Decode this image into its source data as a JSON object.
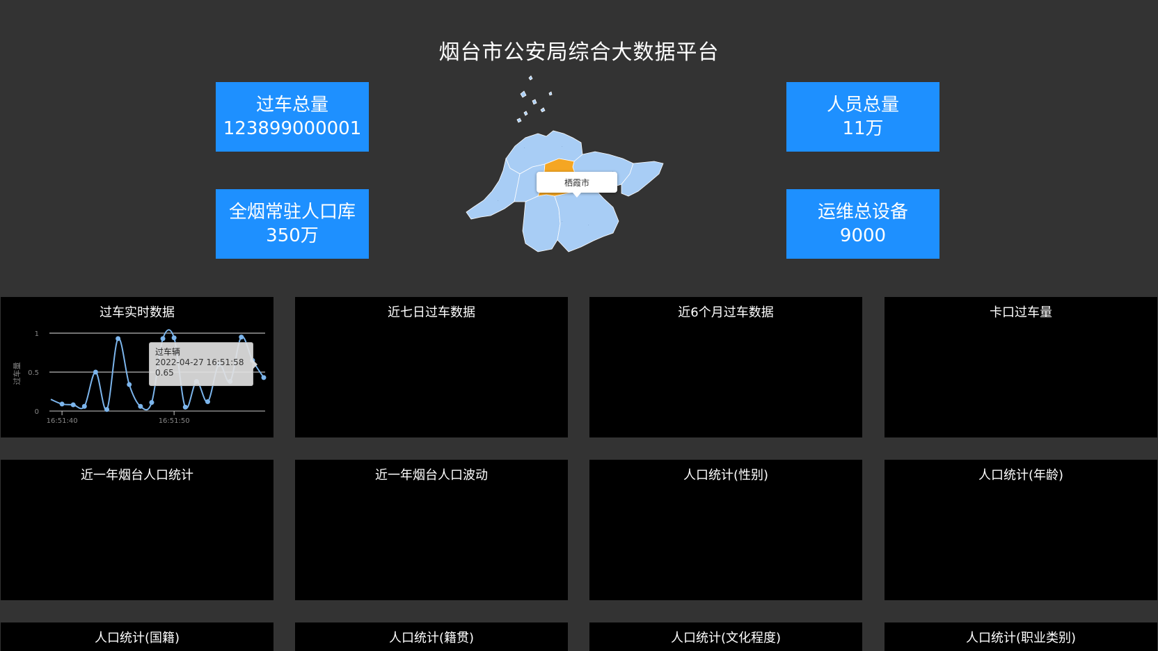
{
  "page": {
    "title": "烟台市公安局综合大数据平台"
  },
  "stats": [
    {
      "label": "过车总量",
      "value": "123899000001"
    },
    {
      "label": "全烟常驻人口库",
      "value": "350万"
    },
    {
      "label": "人员总量",
      "value": "11万"
    },
    {
      "label": "运维总设备",
      "value": "9000"
    }
  ],
  "map": {
    "highlight_label": "栖霞市",
    "highlight_color": "#f5a623",
    "region_color": "#a8cdf5"
  },
  "panels": {
    "row1": [
      "过车实时数据",
      "近七日过车数据",
      "近6个月过车数据",
      "卡口过车量"
    ],
    "row2": [
      "近一年烟台人口统计",
      "近一年烟台人口波动",
      "人口统计(性别)",
      "人口统计(年龄)"
    ],
    "row3": [
      "人口统计(国籍)",
      "人口统计(籍贯)",
      "人口统计(文化程度)",
      "人口统计(职业类别)"
    ]
  },
  "chart_data": {
    "type": "line",
    "title": "过车实时数据",
    "ylabel": "过车量",
    "x_tick_labels": [
      "16:51:40",
      "16:51:50"
    ],
    "y_tick_labels": [
      "0",
      "0.5",
      "1"
    ],
    "ylim": [
      0,
      1
    ],
    "series": [
      {
        "name": "过车辆",
        "values": [
          0.15,
          0.09,
          0.08,
          0.06,
          0.5,
          0.02,
          0.93,
          0.34,
          0.06,
          0.11,
          0.93,
          0.94,
          0.05,
          0.38,
          0.12,
          0.6,
          0.38,
          0.95,
          0.65,
          0.43
        ]
      }
    ],
    "grid": true,
    "color": "#7cb5ec"
  },
  "tooltip": {
    "series": "过车辆",
    "time": "2022-04-27 16:51:58",
    "value": "0.65"
  }
}
